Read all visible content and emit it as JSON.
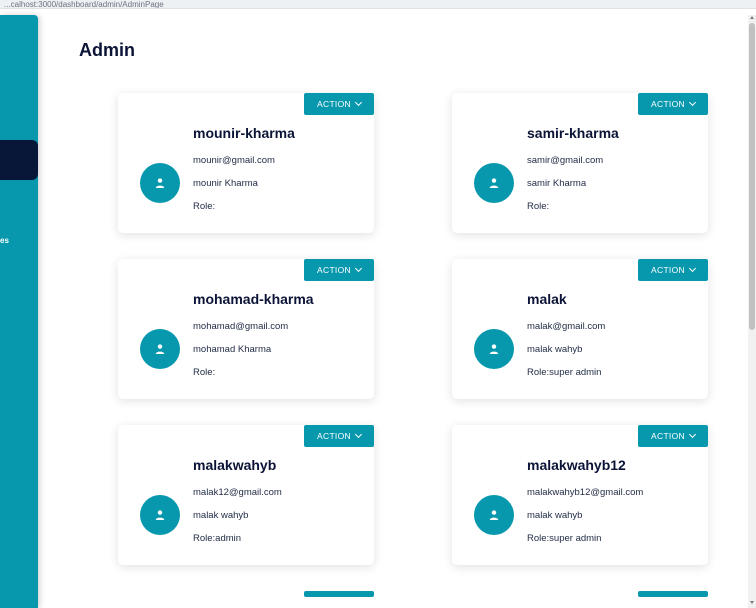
{
  "browser": {
    "url_fragment": "...calhost:3000/dashboard/admin/AdminPage"
  },
  "sidebar": {
    "partial_label": "es"
  },
  "page": {
    "title": "Admin"
  },
  "theme": {
    "accent": "#0798ad",
    "sidebar_active": "#081638",
    "title_color": "#0b1437"
  },
  "cards": [
    {
      "name": "mounir-kharma",
      "email": "mounir@gmail.com",
      "fullname": "mounir Kharma",
      "role": "Role:",
      "action": "ACTION"
    },
    {
      "name": "samir-kharma",
      "email": "samir@gmail.com",
      "fullname": "samir Kharma",
      "role": "Role:",
      "action": "ACTION"
    },
    {
      "name": "mohamad-kharma",
      "email": "mohamad@gmail.com",
      "fullname": "mohamad Kharma",
      "role": "Role:",
      "action": "ACTION"
    },
    {
      "name": "malak",
      "email": "malak@gmail.com",
      "fullname": "malak wahyb",
      "role": "Role:super admin",
      "action": "ACTION"
    },
    {
      "name": "malakwahyb",
      "email": "malak12@gmail.com",
      "fullname": "malak wahyb",
      "role": "Role:admin",
      "action": "ACTION"
    },
    {
      "name": "malakwahyb12",
      "email": "malakwahyb12@gmail.com",
      "fullname": "malak wahyb",
      "role": "Role:super admin",
      "action": "ACTION"
    }
  ]
}
